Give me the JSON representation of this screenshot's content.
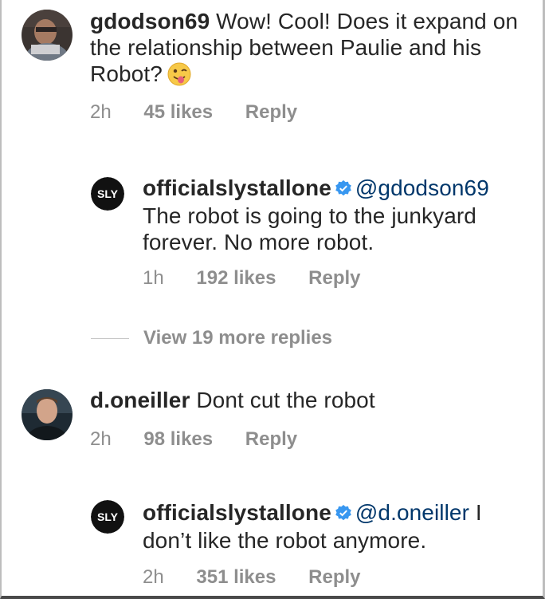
{
  "comments": [
    {
      "username": "gdodson69",
      "text": "Wow!  Cool!  Does it expand on the relationship between Paulie and his Robot?",
      "emoji": "winking-face-with-tongue",
      "time": "2h",
      "likes": "45 likes",
      "reply": "Reply"
    },
    {
      "username": "officialslystallone",
      "verified": true,
      "mention": "@gdodson69",
      "text": "The robot is going to the junkyard forever. No more robot.",
      "avatar_text": "SLY",
      "time": "1h",
      "likes": "192 likes",
      "reply": "Reply"
    },
    {
      "username": "d.oneiller",
      "text": "Dont cut the robot",
      "time": "2h",
      "likes": "98 likes",
      "reply": "Reply"
    },
    {
      "username": "officialslystallone",
      "verified": true,
      "mention": "@d.oneiller",
      "text": "I don’t like the robot anymore.",
      "avatar_text": "SLY",
      "time": "2h",
      "likes": "351 likes",
      "reply": "Reply"
    }
  ],
  "view_more": "View 19 more replies",
  "colors": {
    "text": "#262626",
    "meta": "#8e8e8e",
    "mention": "#00376b",
    "verified": "#3897f0"
  }
}
